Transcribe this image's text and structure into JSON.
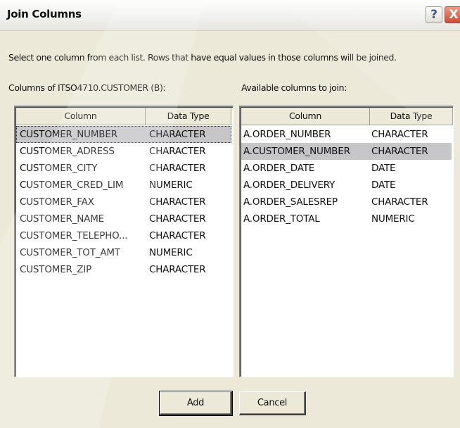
{
  "dialog": {
    "title": "Join Columns",
    "help_glyph": "?",
    "close_glyph": "X",
    "instructions": "Select one column from each list.  Rows that have equal values in those columns will be joined.",
    "left_caption": "Columns of ITSO4710.CUSTOMER (B):",
    "right_caption": "Available columns to join:"
  },
  "left_list": {
    "headers": [
      "Column",
      "Data Type"
    ],
    "selected_index": 0,
    "rows": [
      [
        "CUSTOMER_NUMBER",
        "CHARACTER"
      ],
      [
        "CUSTOMER_ADRESS",
        "CHARACTER"
      ],
      [
        "CUSTOMER_CITY",
        "CHARACTER"
      ],
      [
        "CUSTOMER_CRED_LIM",
        "NUMERIC"
      ],
      [
        "CUSTOMER_FAX",
        "CHARACTER"
      ],
      [
        "CUSTOMER_NAME",
        "CHARACTER"
      ],
      [
        "CUSTOMER_TELEPHO...",
        "CHARACTER"
      ],
      [
        "CUSTOMER_TOT_AMT",
        "NUMERIC"
      ],
      [
        "CUSTOMER_ZIP",
        "CHARACTER"
      ]
    ]
  },
  "right_list": {
    "headers": [
      "Column",
      "Data Type"
    ],
    "selected_index": 1,
    "rows": [
      [
        "A.ORDER_NUMBER",
        "CHARACTER"
      ],
      [
        "A.CUSTOMER_NUMBER",
        "CHARACTER"
      ],
      [
        "A.ORDER_DATE",
        "DATE"
      ],
      [
        "A.ORDER_DELIVERY",
        "DATE"
      ],
      [
        "A.ORDER_SALESREP",
        "CHARACTER"
      ],
      [
        "A.ORDER_TOTAL",
        "NUMERIC"
      ]
    ]
  },
  "buttons": {
    "add": "Add",
    "cancel": "Cancel"
  },
  "colors": {
    "dialog_bg": "#ece9d8",
    "selection": "#c6c6c8",
    "close_button": "#c4371a"
  }
}
